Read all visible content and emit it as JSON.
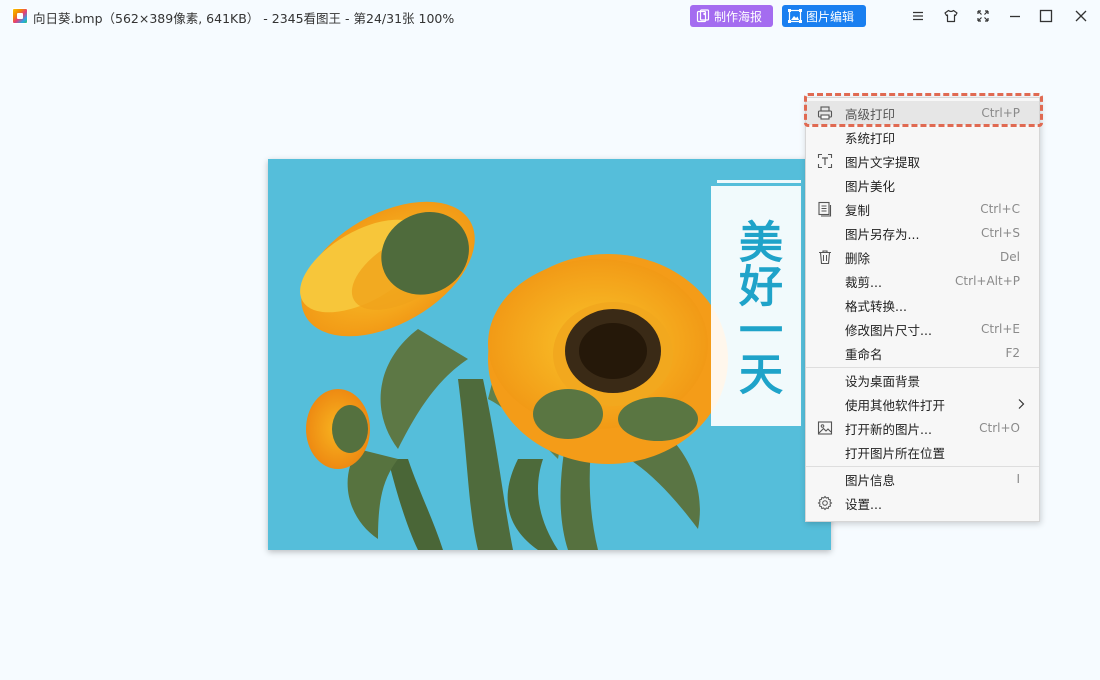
{
  "window": {
    "title": "向日葵.bmp（562×389像素, 641KB） - 2345看图王 - 第24/31张 100%"
  },
  "toolbar": {
    "poster_label": "制作海报",
    "edit_label": "图片编辑"
  },
  "window_controls": [
    "menu-icon",
    "skin-icon",
    "fullscreen-icon",
    "minimize-icon",
    "maximize-icon",
    "close-icon"
  ],
  "menu": {
    "items": [
      {
        "label": "高级打印",
        "shortcut": "Ctrl+P",
        "icon": "printer-icon"
      },
      {
        "label": "系统打印",
        "shortcut": "",
        "icon": ""
      },
      {
        "label": "图片文字提取",
        "shortcut": "",
        "icon": "text-extract-icon"
      },
      {
        "label": "图片美化",
        "shortcut": "",
        "icon": ""
      },
      {
        "label": "复制",
        "shortcut": "Ctrl+C",
        "icon": "copy-icon"
      },
      {
        "label": "图片另存为...",
        "shortcut": "Ctrl+S",
        "icon": ""
      },
      {
        "label": "删除",
        "shortcut": "Del",
        "icon": "trash-icon"
      },
      {
        "label": "裁剪...",
        "shortcut": "Ctrl+Alt+P",
        "icon": ""
      },
      {
        "label": "格式转换...",
        "shortcut": "",
        "icon": ""
      },
      {
        "label": "修改图片尺寸...",
        "shortcut": "Ctrl+E",
        "icon": ""
      },
      {
        "label": "重命名",
        "shortcut": "F2",
        "icon": ""
      },
      {
        "label": "设为桌面背景",
        "shortcut": "",
        "icon": ""
      },
      {
        "label": "使用其他软件打开",
        "shortcut": "",
        "icon": "",
        "submenu": true
      },
      {
        "label": "打开新的图片...",
        "shortcut": "Ctrl+O",
        "icon": "image-icon"
      },
      {
        "label": "打开图片所在位置",
        "shortcut": "",
        "icon": ""
      },
      {
        "label": "图片信息",
        "shortcut": "I",
        "icon": ""
      },
      {
        "label": "设置...",
        "shortcut": "",
        "icon": "gear-icon"
      }
    ]
  },
  "photo": {
    "overlay_text": "美好一天"
  },
  "colors": {
    "background": "#f6fbff",
    "poster_button": "#a46cf0",
    "edit_button": "#1a7ff0",
    "highlight_dash": "#e06a52",
    "overlay_text": "#1fa3c9"
  }
}
